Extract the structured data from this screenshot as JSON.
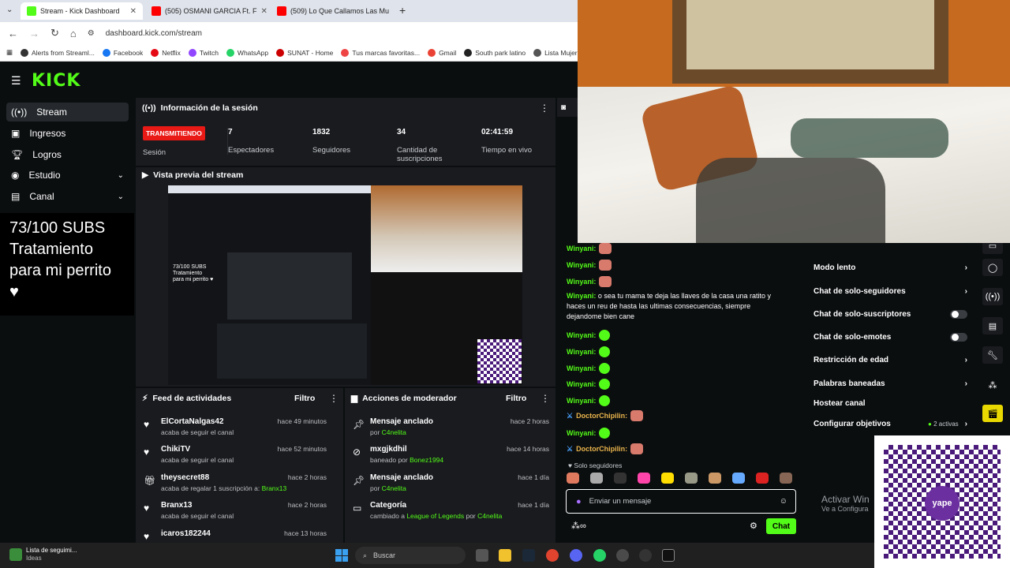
{
  "browser": {
    "tabs": [
      {
        "label": "Stream - Kick Dashboard",
        "color": "#53fc18"
      },
      {
        "label": "(505) OSMANI GARCIA Ft. F",
        "color": "#ff0000"
      },
      {
        "label": "(509) Lo Que Callamos Las Mu",
        "color": "#ff0000"
      }
    ],
    "new_tab": "+",
    "url": "dashboard.kick.com/stream",
    "bookmarks": [
      "Alerts from Streaml...",
      "Facebook",
      "Netflix",
      "Twitch",
      "WhatsApp",
      "SUNAT - Home",
      "Tus marcas favoritas...",
      "Gmail",
      "South park latino",
      "Lista Mujer"
    ]
  },
  "brand": {
    "logo": "KICK",
    "accent": "#53fc18"
  },
  "sidebar": {
    "items": [
      {
        "label": "Stream",
        "icon": "broadcast-icon"
      },
      {
        "label": "Ingresos",
        "icon": "money-icon"
      },
      {
        "label": "Logros",
        "icon": "trophy-icon"
      },
      {
        "label": "Estudio",
        "icon": "studio-icon",
        "chev": "⌄"
      },
      {
        "label": "Canal",
        "icon": "channel-icon",
        "chev": "⌄"
      }
    ]
  },
  "overlay_text": {
    "line1": "73/100 SUBS",
    "line2": "Tratamiento",
    "line3": "para mi perrito ♥"
  },
  "session": {
    "title": "Información de la sesión",
    "status_badge": "TRANSMITIENDO",
    "status_label": "Sesión",
    "stats": [
      {
        "value": "7",
        "label": "Espectadores"
      },
      {
        "value": "1832",
        "label": "Seguidores"
      },
      {
        "value": "34",
        "label": "Cantidad de suscripciones"
      },
      {
        "value": "02:41:59",
        "label": "Tiempo en vivo"
      }
    ]
  },
  "preview": {
    "title": "Vista previa del stream"
  },
  "activity": {
    "title": "Feed de actividades",
    "filter": "Filtro",
    "rows": [
      {
        "name": "ElCortaNalgas42",
        "sub": "acaba de seguir el canal",
        "time": "hace 49 minutos",
        "icon": "heart-icon"
      },
      {
        "name": "ChikiTV",
        "sub": "acaba de seguir el canal",
        "time": "hace 52 minutos",
        "icon": "heart-icon"
      },
      {
        "name": "theysecret88",
        "sub": "acaba de regalar 1 suscripción a: ",
        "sub_hl": "Branx13",
        "time": "hace 2 horas",
        "icon": "gift-icon"
      },
      {
        "name": "Branx13",
        "sub": "acaba de seguir el canal",
        "time": "hace 2 horas",
        "icon": "heart-icon"
      },
      {
        "name": "icaros182244",
        "sub": "",
        "time": "hace 13 horas",
        "icon": "heart-icon"
      }
    ]
  },
  "moderator": {
    "title": "Acciones de moderador",
    "filter": "Filtro",
    "rows": [
      {
        "name": "Mensaje anclado",
        "pre": "por ",
        "hl": "C4nelita",
        "time": "hace 2 horas",
        "icon": "pin-icon"
      },
      {
        "name": "mxgjkdhil",
        "pre": "baneado por ",
        "hl": "Bonez1994",
        "time": "hace 14 horas",
        "icon": "ban-icon"
      },
      {
        "name": "Mensaje anclado",
        "pre": "por ",
        "hl": "C4nelita",
        "time": "hace 1 día",
        "icon": "pin-icon"
      },
      {
        "name": "Categoría",
        "pre": "cambiado a ",
        "hl": "League of Legends",
        "post": " por ",
        "hl2": "C4nelita",
        "time": "hace 1 día",
        "icon": "category-icon"
      }
    ]
  },
  "chat": {
    "lines": [
      {
        "user": "Winyani:",
        "emote": "face"
      },
      {
        "user": "Winyani:",
        "emote": "face"
      },
      {
        "user": "Winyani:",
        "emote": "face"
      },
      {
        "user": "Winyani:",
        "emote": "kick"
      },
      {
        "user": "Winyani:",
        "emote": "kick"
      },
      {
        "user": "Winyani:",
        "emote": "kick"
      },
      {
        "user": "Winyani:",
        "emote": "kick"
      },
      {
        "user": "Winyani:",
        "emote": "kick"
      },
      {
        "user": "DoctorChipilin:",
        "emote": "face"
      },
      {
        "user": "Winyani:",
        "emote": "kick"
      },
      {
        "user": "DoctorChipilin:",
        "emote": "face"
      }
    ],
    "long_message": {
      "user": "Winyani:",
      "text": " o sea tu mama te deja las llaves de la casa una ratito y haces un reu de hasta las ultimas consecuencias, siempre dejandome bien cane"
    },
    "followers_only": "Solo seguidores",
    "input_placeholder": "Enviar un mensaje",
    "send_button": "Chat"
  },
  "mod_settings": [
    {
      "label": "Modo lento",
      "type": "chev"
    },
    {
      "label": "Chat de solo-seguidores",
      "type": "chev"
    },
    {
      "label": "Chat de solo-suscriptores",
      "type": "toggle"
    },
    {
      "label": "Chat de solo-emotes",
      "type": "toggle"
    },
    {
      "label": "Restricción de edad",
      "type": "chev"
    },
    {
      "label": "Palabras baneadas",
      "type": "chev"
    },
    {
      "label": "Hostear canal",
      "type": "none"
    },
    {
      "label": "Configurar objetivos",
      "type": "chev",
      "extra": "2 activas"
    }
  ],
  "windows_watermark": {
    "line1": "Activar Win",
    "line2": "Ve a Configura"
  },
  "qr_brand": "yape",
  "taskbar": {
    "search": "Buscar",
    "notif_title": "Lista de seguimi...",
    "notif_sub": "Ideas"
  }
}
